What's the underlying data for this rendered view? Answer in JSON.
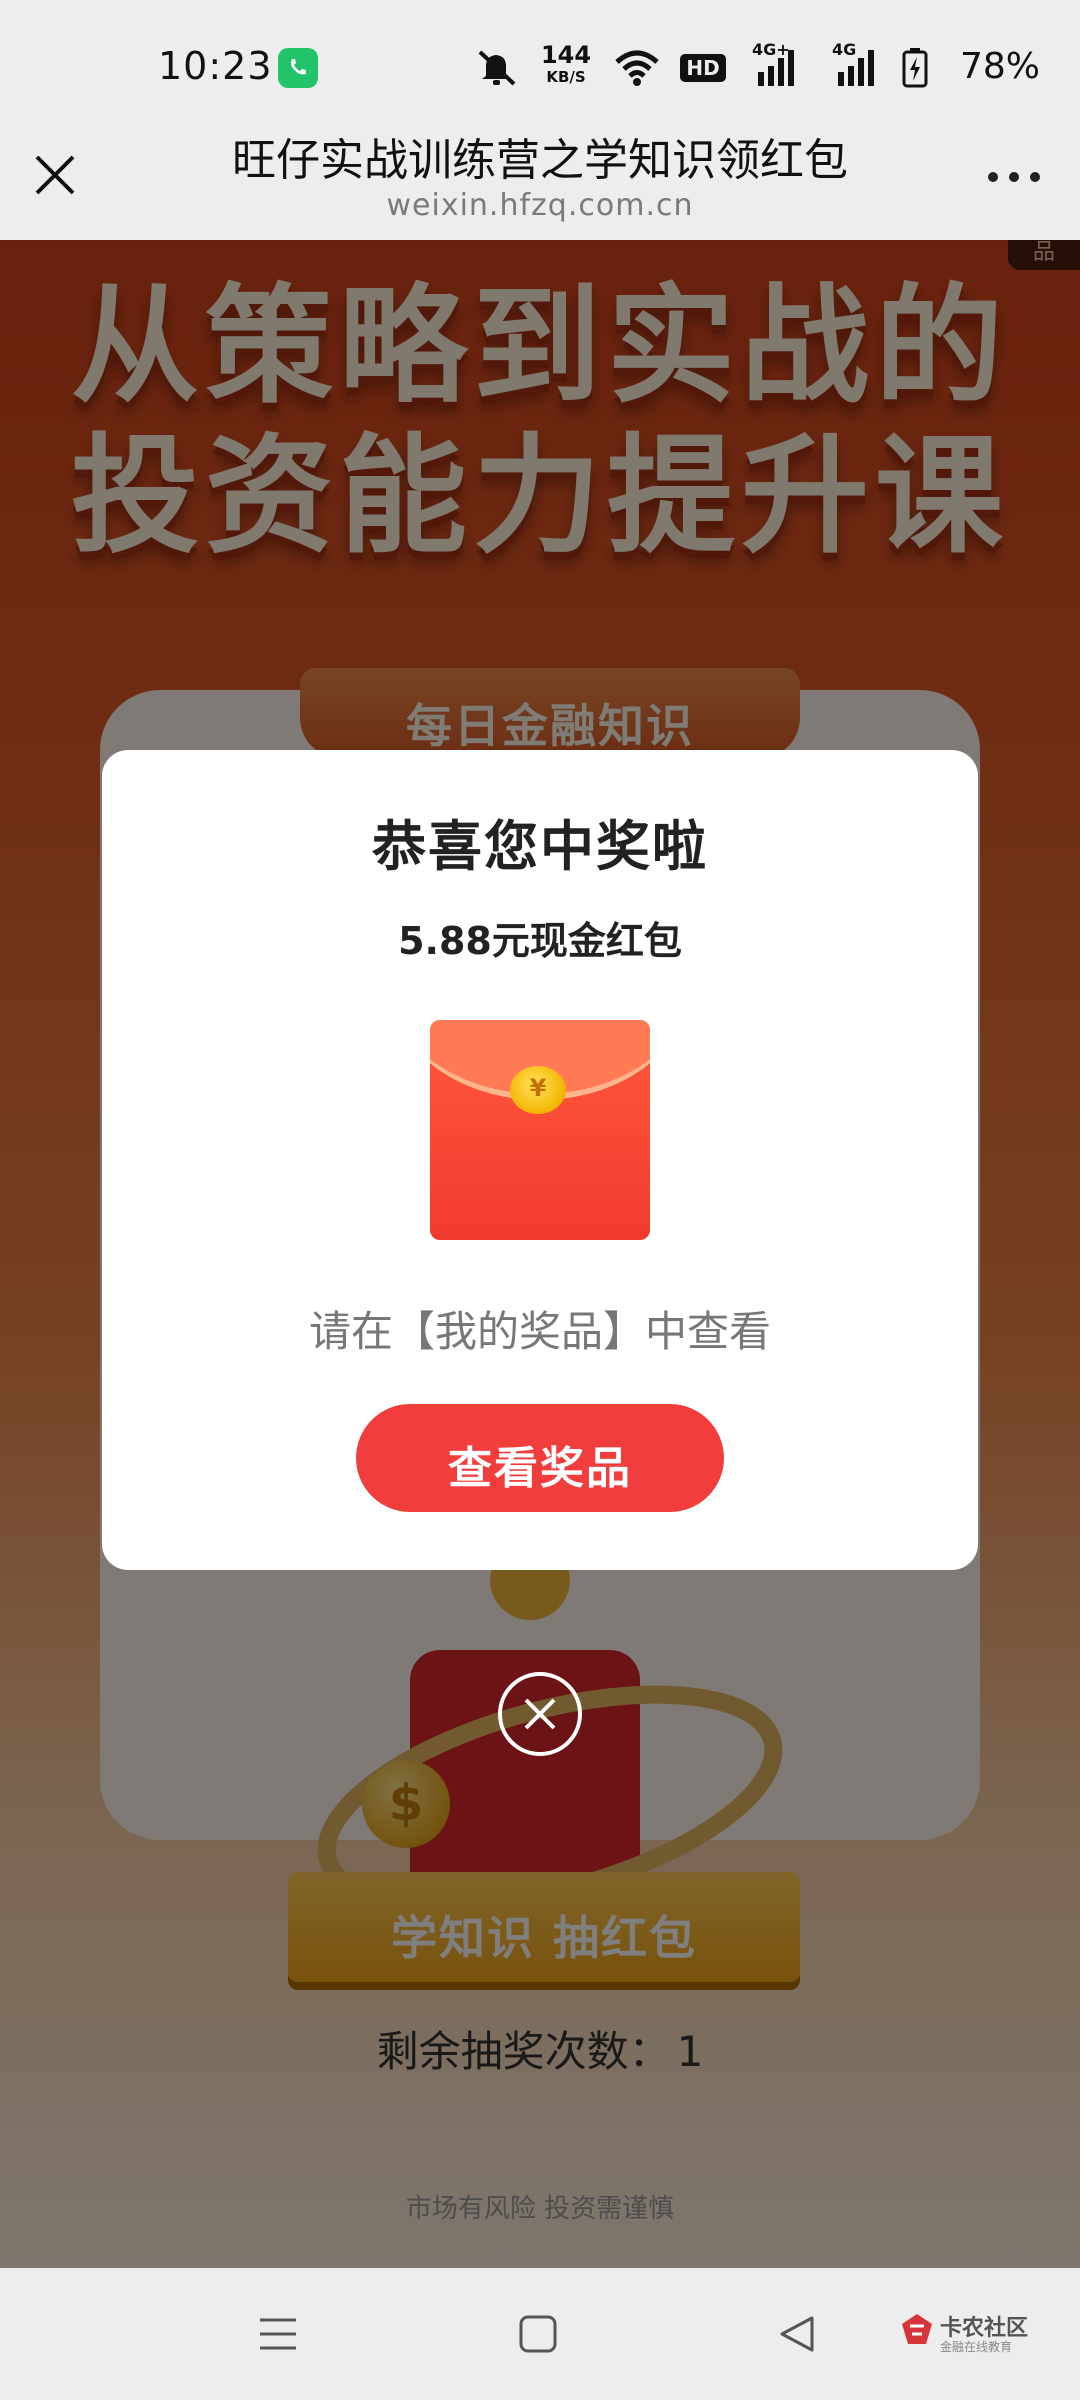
{
  "status_bar": {
    "time": "10:23",
    "net_speed_value": "144",
    "net_speed_unit": "KB/S",
    "hd_label": "HD",
    "signal1_label": "4G+",
    "signal2_label": "4G",
    "battery": "78%",
    "icons": [
      "phone-call-icon",
      "mute-icon",
      "wifi-icon",
      "hd-icon",
      "signal-icon",
      "battery-charging-icon"
    ]
  },
  "title_bar": {
    "title": "旺仔实战训练营之学知识领红包",
    "url": "weixin.hfzq.com.cn",
    "close_icon": "close-icon",
    "more_icon": "more-icon"
  },
  "page": {
    "side_tab": "品",
    "hero_line_1": "从策略到实战的",
    "hero_line_2": "投资能力提升课",
    "ribbon": "每日金融知识",
    "draw_button": "学知识 抽红包",
    "remaining_label": "剩余抽奖次数：",
    "remaining_value": "1",
    "risk_note": "市场有风险 投资需谨慎"
  },
  "modal": {
    "title": "恭喜您中奖啦",
    "prize": "5.88元现金红包",
    "envelope_symbol": "¥",
    "hint": "请在【我的奖品】中查看",
    "button": "查看奖品"
  },
  "nav_bar": {
    "watermark": "卡农社区",
    "watermark_sub": "金融在线教育"
  },
  "colors": {
    "accent_red": "#f23d3d",
    "page_orange": "#df5a28",
    "gold": "#f3a318"
  }
}
